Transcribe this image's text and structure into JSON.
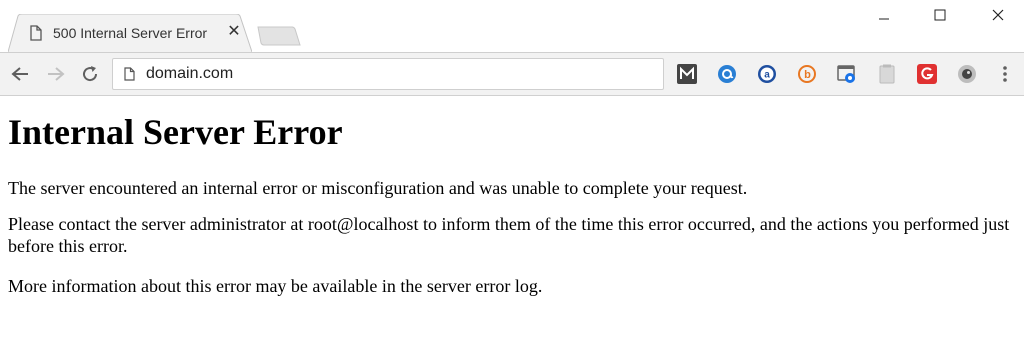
{
  "browser": {
    "tab": {
      "title": "500 Internal Server Error",
      "close_label": "✕"
    },
    "window_controls": {
      "minimize": "—",
      "maximize": "☐",
      "close": "✕"
    },
    "address_bar": {
      "url": "domain.com"
    },
    "extensions": [
      {
        "name": "mailtrack-icon",
        "color": "#444444"
      },
      {
        "name": "at-sign-icon",
        "color": "#2a7fd4"
      },
      {
        "name": "amazon-assistant-icon",
        "color": "#1f4fa0"
      },
      {
        "name": "b-logo-icon",
        "color": "#e87722"
      },
      {
        "name": "screenshot-icon",
        "color": "#1a73e8"
      },
      {
        "name": "clipboard-icon",
        "color": "#bbbbbb"
      },
      {
        "name": "grammarly-icon",
        "color": "#e03131"
      },
      {
        "name": "camera-lens-icon",
        "color": "#555555"
      }
    ]
  },
  "page": {
    "heading": "Internal Server Error",
    "paragraphs": [
      "The server encountered an internal error or misconfiguration and was unable to complete your request.",
      "Please contact the server administrator at root@localhost to inform them of the time this error occurred, and the actions you performed just before this error.",
      "More information about this error may be available in the server error log."
    ]
  }
}
